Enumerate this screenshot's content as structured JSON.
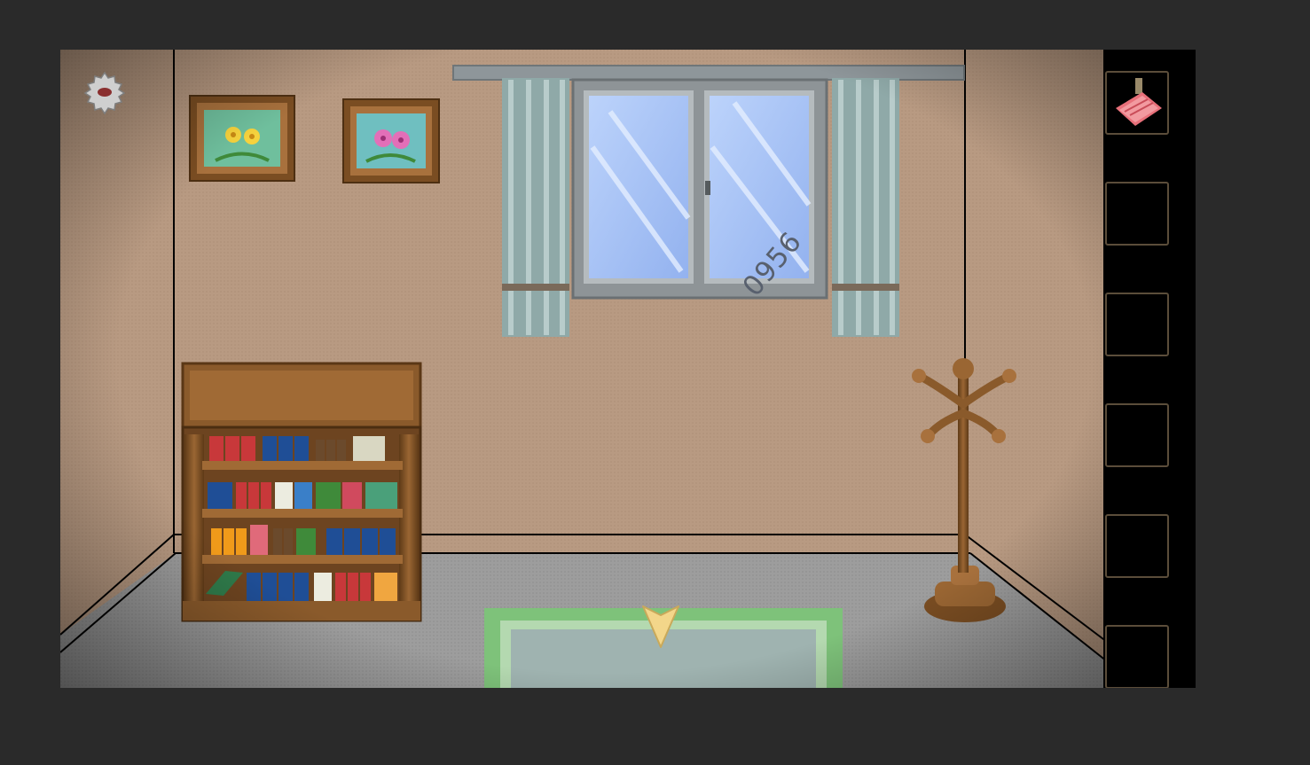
{
  "scene": {
    "window_code": "0956"
  },
  "icons": {
    "settings": "gear-icon",
    "navigate_down": "arrow-down-icon",
    "inventory_item_1": "red-bookmark-ribbon-icon"
  },
  "colors": {
    "wall": "#b89a82",
    "floor": "#9b9b9b",
    "rug_border": "#7ec27a",
    "rug_inner": "#9fb3b0",
    "wood": "#7a4d22",
    "curtain": "#8fa9a8",
    "glass": "#a7c6f7",
    "inventory_slot_border": "#5b4d3a",
    "arrow": "#f3d68a"
  },
  "inventory": {
    "slots": 6,
    "filled_slots": 1
  }
}
